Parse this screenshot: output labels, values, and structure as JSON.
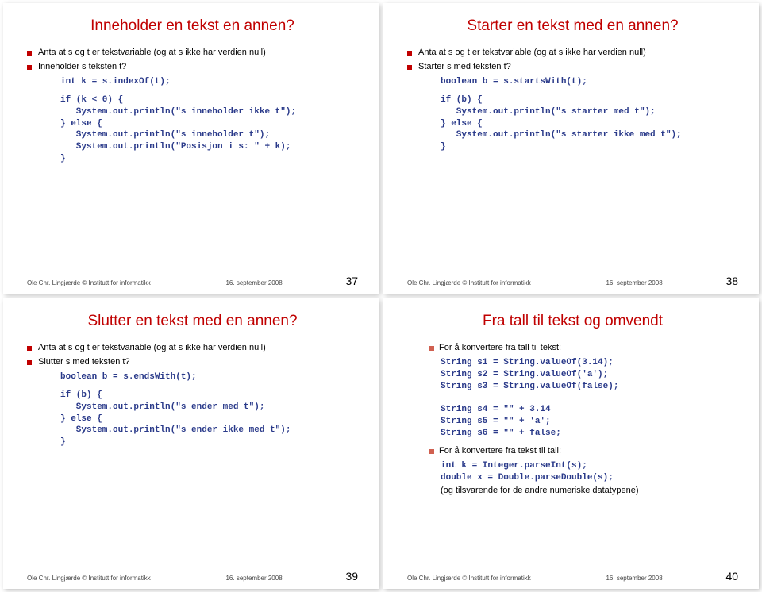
{
  "slides": [
    {
      "title": "Inneholder en tekst en annen?",
      "b1": "Anta at s og t er tekstvariable (og at s ikke har verdien null)",
      "b2": "Inneholder s teksten t?",
      "code1": "int k = s.indexOf(t);",
      "code2": "if (k < 0) {\n   System.out.println(\"s inneholder ikke t\");\n} else {\n   System.out.println(\"s inneholder t\");\n   System.out.println(\"Posisjon i s: \" + k);\n}",
      "num": "37"
    },
    {
      "title": "Starter en tekst med en annen?",
      "b1": "Anta at s og t er tekstvariable (og at s ikke har verdien null)",
      "b2": "Starter s med teksten t?",
      "code1": "boolean b = s.startsWith(t);",
      "code2": "if (b) {\n   System.out.println(\"s starter med t\");\n} else {\n   System.out.println(\"s starter ikke med t\");\n}",
      "num": "38"
    },
    {
      "title": "Slutter en tekst med en annen?",
      "b1": "Anta at s og t er tekstvariable (og at s ikke har verdien null)",
      "b2": "Slutter s med teksten t?",
      "code1": "boolean b = s.endsWith(t);",
      "code2": "if (b) {\n   System.out.println(\"s ender med t\");\n} else {\n   System.out.println(\"s ender ikke med t\");\n}",
      "num": "39"
    },
    {
      "title": "Fra tall til tekst og omvendt",
      "b1": "For å konvertere fra tall til tekst:",
      "code1": "String s1 = String.valueOf(3.14);\nString s2 = String.valueOf('a');\nString s3 = String.valueOf(false);\n\nString s4 = \"\" + 3.14\nString s5 = \"\" + 'a';\nString s6 = \"\" + false;",
      "b2": "For å konvertere fra tekst til tall:",
      "code2": "int k = Integer.parseInt(s);\ndouble x = Double.parseDouble(s);",
      "paren": "(og tilsvarende for de andre numeriske datatypene)",
      "num": "40"
    }
  ],
  "footer": {
    "author": "Ole Chr. Lingjærde © Institutt for informatikk",
    "date": "16. september 2008"
  }
}
